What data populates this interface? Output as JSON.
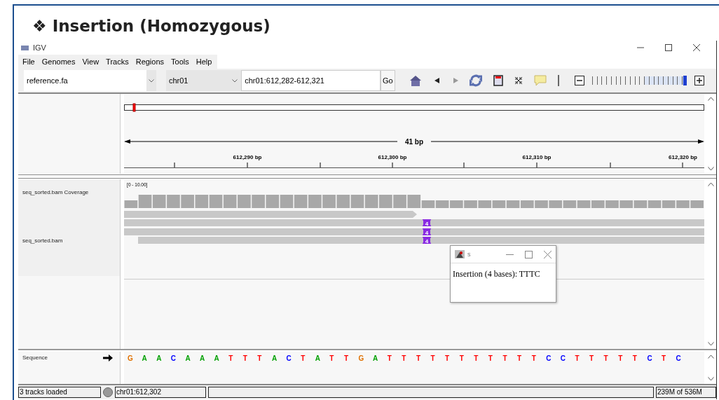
{
  "slide_title": {
    "bullet": "❖",
    "text": "Insertion (Homozygous)"
  },
  "window": {
    "title": "IGV"
  },
  "menu": [
    "File",
    "Genomes",
    "View",
    "Tracks",
    "Regions",
    "Tools",
    "Help"
  ],
  "toolbar": {
    "genome": "reference.fa",
    "chromosome": "chr01",
    "locus": "chr01:612,282-612,321",
    "go": "Go",
    "zoom": {
      "level": 1
    }
  },
  "ruler": {
    "span": "41 bp",
    "ticks": [
      "612,290 bp",
      "612,300 bp",
      "612,310 bp",
      "612,320 bp"
    ]
  },
  "tracks": [
    {
      "name": "seq_sorted.bam Coverage",
      "range": "[0 - 10.00]"
    },
    {
      "name": "seq_sorted.bam"
    }
  ],
  "reads": [
    {
      "kind": "arrow"
    },
    {
      "kind": "bar",
      "insertion": "4"
    },
    {
      "kind": "bar",
      "insertion": "4"
    },
    {
      "kind": "bar",
      "insertion": "4"
    }
  ],
  "popup": {
    "title": "s",
    "text": "Insertion (4 bases): TTTC"
  },
  "sequence": {
    "name": "Sequence",
    "bases": [
      {
        "base": "G",
        "color": "#e07000"
      },
      {
        "base": "A",
        "color": "#00a000"
      },
      {
        "base": "A",
        "color": "#00a000"
      },
      {
        "base": "C",
        "color": "#0000ff"
      },
      {
        "base": "A",
        "color": "#00a000"
      },
      {
        "base": "A",
        "color": "#00a000"
      },
      {
        "base": "A",
        "color": "#00a000"
      },
      {
        "base": "T",
        "color": "#ff0000"
      },
      {
        "base": "T",
        "color": "#ff0000"
      },
      {
        "base": "T",
        "color": "#ff0000"
      },
      {
        "base": "A",
        "color": "#00a000"
      },
      {
        "base": "C",
        "color": "#0000ff"
      },
      {
        "base": "T",
        "color": "#ff0000"
      },
      {
        "base": "A",
        "color": "#00a000"
      },
      {
        "base": "T",
        "color": "#ff0000"
      },
      {
        "base": "T",
        "color": "#ff0000"
      },
      {
        "base": "G",
        "color": "#e07000"
      },
      {
        "base": "A",
        "color": "#00a000"
      },
      {
        "base": "T",
        "color": "#ff0000"
      },
      {
        "base": "T",
        "color": "#ff0000"
      },
      {
        "base": "T",
        "color": "#ff0000"
      },
      {
        "base": "T",
        "color": "#ff0000"
      },
      {
        "base": "T",
        "color": "#ff0000"
      },
      {
        "base": "T",
        "color": "#ff0000"
      },
      {
        "base": "T",
        "color": "#ff0000"
      },
      {
        "base": "T",
        "color": "#ff0000"
      },
      {
        "base": "T",
        "color": "#ff0000"
      },
      {
        "base": "T",
        "color": "#ff0000"
      },
      {
        "base": "T",
        "color": "#ff0000"
      },
      {
        "base": "C",
        "color": "#0000ff"
      },
      {
        "base": "C",
        "color": "#0000ff"
      },
      {
        "base": "T",
        "color": "#ff0000"
      },
      {
        "base": "T",
        "color": "#ff0000"
      },
      {
        "base": "T",
        "color": "#ff0000"
      },
      {
        "base": "T",
        "color": "#ff0000"
      },
      {
        "base": "T",
        "color": "#ff0000"
      },
      {
        "base": "C",
        "color": "#0000ff"
      },
      {
        "base": "T",
        "color": "#ff0000"
      },
      {
        "base": "C",
        "color": "#0000ff"
      }
    ]
  },
  "status_bar": {
    "message": "3 tracks loaded",
    "position": "chr01:612,302",
    "memory": "239M of 536M"
  }
}
